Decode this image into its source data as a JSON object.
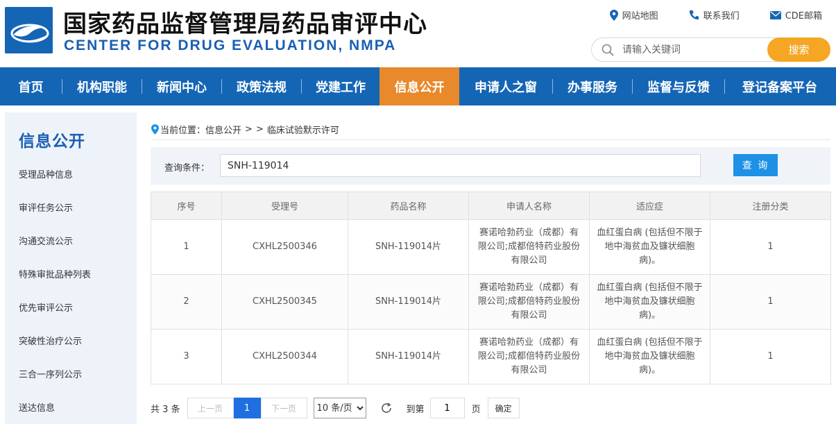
{
  "header": {
    "title_cn": "国家药品监督管理局药品审评中心",
    "title_en": "CENTER FOR DRUG EVALUATION, NMPA",
    "links": [
      {
        "label": "网站地图",
        "icon": "location-pin-icon"
      },
      {
        "label": "联系我们",
        "icon": "phone-icon"
      },
      {
        "label": "CDE邮箱",
        "icon": "mail-icon"
      }
    ],
    "search": {
      "placeholder": "请输入关键词",
      "button": "搜索"
    }
  },
  "nav": {
    "items": [
      {
        "label": "首页"
      },
      {
        "label": "机构职能"
      },
      {
        "label": "新闻中心"
      },
      {
        "label": "政策法规"
      },
      {
        "label": "党建工作"
      },
      {
        "label": "信息公开",
        "active": true
      },
      {
        "label": "申请人之窗"
      },
      {
        "label": "办事服务"
      },
      {
        "label": "监督与反馈"
      },
      {
        "label": "登记备案平台"
      }
    ]
  },
  "sidebar": {
    "title": "信息公开",
    "items": [
      {
        "label": "受理品种信息"
      },
      {
        "label": "审评任务公示"
      },
      {
        "label": "沟通交流公示"
      },
      {
        "label": "特殊审批品种列表"
      },
      {
        "label": "优先审评公示"
      },
      {
        "label": "突破性治疗公示"
      },
      {
        "label": "三合一序列公示"
      },
      {
        "label": "送达信息"
      }
    ]
  },
  "breadcrumb": {
    "prefix": "当前位置：",
    "section": "信息公开",
    "separator": ">",
    "separator2": ">",
    "current": "临床试验默示许可"
  },
  "query": {
    "label": "查询条件：",
    "value": "SNH-119014",
    "button": "查 询"
  },
  "table": {
    "columns": [
      "序号",
      "受理号",
      "药品名称",
      "申请人名称",
      "适应症",
      "注册分类"
    ],
    "rows": [
      [
        "1",
        "CXHL2500346",
        "SNH-119014片",
        "赛诺哈勃药业（成都）有限公司;成都倍特药业股份有限公司",
        "血红蛋白病 (包括但不限于地中海贫血及镰状细胞病)。",
        "1"
      ],
      [
        "2",
        "CXHL2500345",
        "SNH-119014片",
        "赛诺哈勃药业（成都）有限公司;成都倍特药业股份有限公司",
        "血红蛋白病 (包括但不限于地中海贫血及镰状细胞病)。",
        "1"
      ],
      [
        "3",
        "CXHL2500344",
        "SNH-119014片",
        "赛诺哈勃药业（成都）有限公司;成都倍特药业股份有限公司",
        "血红蛋白病 (包括但不限于地中海贫血及镰状细胞病)。",
        "1"
      ]
    ]
  },
  "pagination": {
    "total": "共 3 条",
    "prev": "上一页",
    "current_page": "1",
    "next": "下一页",
    "page_size": "10 条/页",
    "page_size_options": [
      "10 条/页"
    ],
    "goto_label": "到第",
    "goto_value": "1",
    "goto_unit": "页",
    "confirm": "确定"
  },
  "colors": {
    "brand_blue": "#1565b5",
    "active_orange": "#e8892b",
    "search_orange": "#f5a623",
    "query_blue": "#1e90e6",
    "page_blue": "#1e6fe0"
  }
}
